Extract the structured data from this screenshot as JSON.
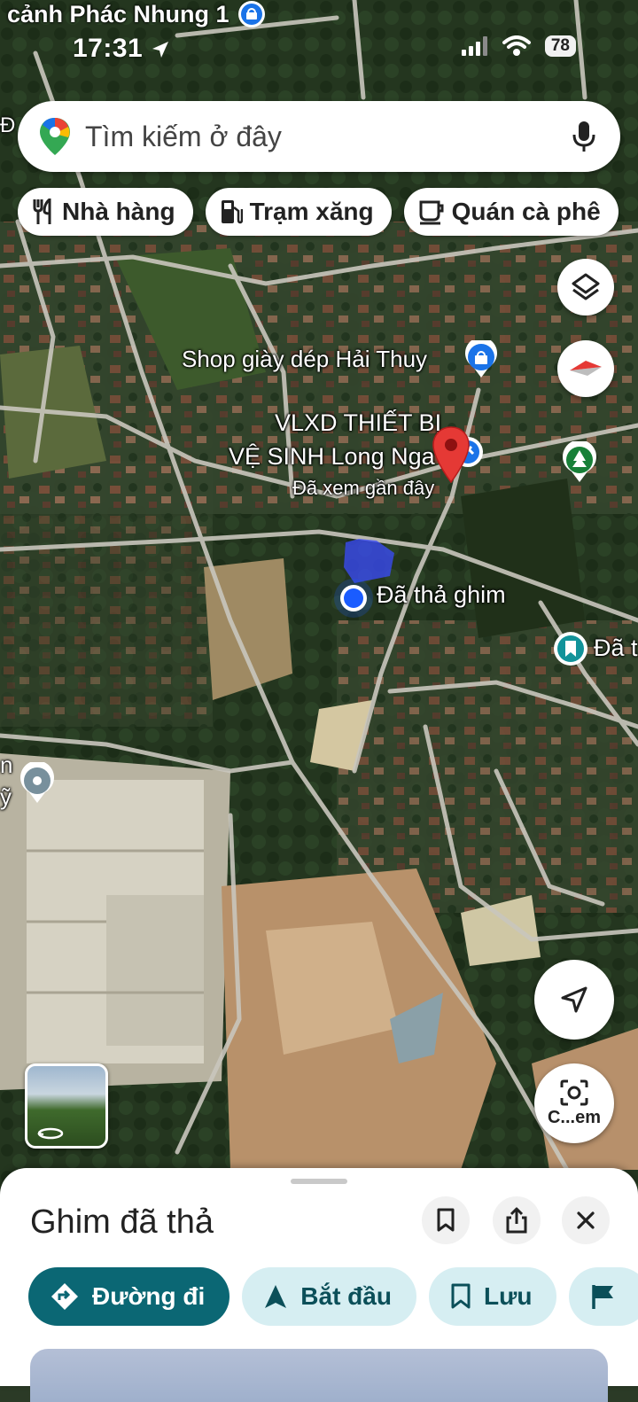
{
  "status_bar": {
    "time": "17:31",
    "battery": "78"
  },
  "top_place_label": "cảnh Phác Nhung 1",
  "search": {
    "placeholder": "Tìm kiếm ở đây"
  },
  "chips": [
    {
      "label": "Nhà hàng",
      "icon": "restaurant-icon"
    },
    {
      "label": "Trạm xăng",
      "icon": "gas-station-icon"
    },
    {
      "label": "Quán cà phê",
      "icon": "coffee-icon"
    }
  ],
  "map_labels": {
    "shop": "Shop giày dép Hải Thuy",
    "vlxd_line1": "VLXD THIẾT BỊ",
    "vlxd_line2": "VỆ SINH Long Nga",
    "recent": "Đã xem gần đây",
    "dropped_pin": "Đã thả ghim",
    "right_cut": "Đã t",
    "left_cut1": "n",
    "left_cut2": "ỹ",
    "top_left_cut": "Đ"
  },
  "buttons": {
    "lens_label": "C...em"
  },
  "sheet": {
    "title": "Ghim đã thả",
    "actions": [
      {
        "label": "Đường đi",
        "icon": "directions-icon"
      },
      {
        "label": "Bắt đầu",
        "icon": "navigation-arrow-icon"
      },
      {
        "label": "Lưu",
        "icon": "bookmark-icon"
      },
      {
        "label": "",
        "icon": "flag-icon"
      }
    ]
  },
  "colors": {
    "primary_action": "#0b6774",
    "secondary_action": "#d6eef2",
    "pin_red": "#e53935",
    "location_blue": "#1a5cff"
  }
}
